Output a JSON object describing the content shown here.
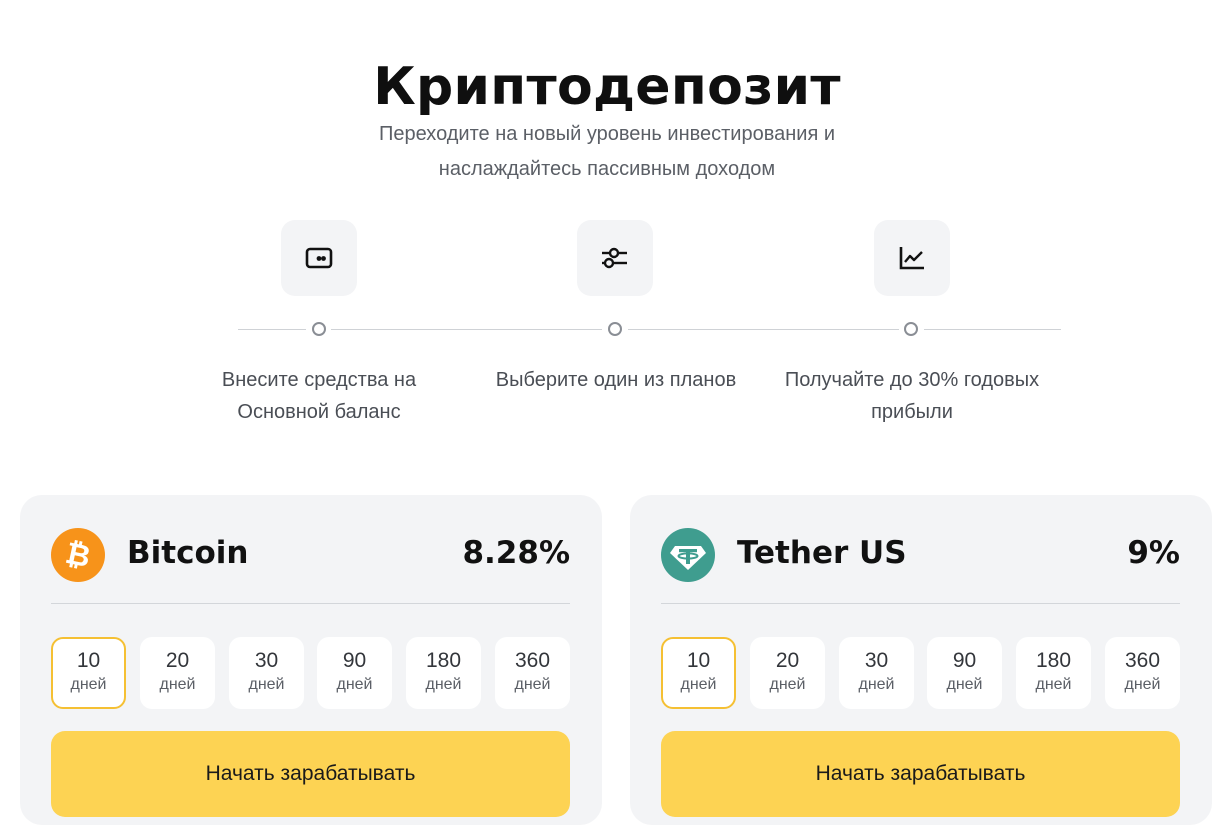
{
  "page": {
    "title": "Криптодепозит",
    "subtitle_line1": "Переходите на новый уровень инвестирования и",
    "subtitle_line2": "наслаждайтесь пассивным доходом"
  },
  "steps": [
    {
      "icon": "wallet-icon",
      "text_line1": "Внесите средства на",
      "text_line2": "Основной баланс"
    },
    {
      "icon": "sliders-icon",
      "text_line1": "Выберите один из планов",
      "text_line2": ""
    },
    {
      "icon": "chart-icon",
      "text_line1": "Получайте до 30% годовых",
      "text_line2": "прибыли"
    }
  ],
  "cards": [
    {
      "coin": "Bitcoin",
      "rate": "8.28%",
      "icon": "bitcoin-icon",
      "icon_color": "#f7931a",
      "selected_period": "10",
      "periods": [
        {
          "num": "10",
          "unit": "дней"
        },
        {
          "num": "20",
          "unit": "дней"
        },
        {
          "num": "30",
          "unit": "дней"
        },
        {
          "num": "90",
          "unit": "дней"
        },
        {
          "num": "180",
          "unit": "дней"
        },
        {
          "num": "360",
          "unit": "дней"
        }
      ],
      "cta": "Начать зарабатывать"
    },
    {
      "coin": "Tether US",
      "rate": "9%",
      "icon": "tether-icon",
      "icon_color": "#3f9d8f",
      "selected_period": "10",
      "periods": [
        {
          "num": "10",
          "unit": "дней"
        },
        {
          "num": "20",
          "unit": "дней"
        },
        {
          "num": "30",
          "unit": "дней"
        },
        {
          "num": "90",
          "unit": "дней"
        },
        {
          "num": "180",
          "unit": "дней"
        },
        {
          "num": "360",
          "unit": "дней"
        }
      ],
      "cta": "Начать зарабатывать"
    }
  ],
  "colors": {
    "accent": "#fdd353",
    "selected_border": "#f5c033",
    "card_bg": "#f3f4f6"
  }
}
